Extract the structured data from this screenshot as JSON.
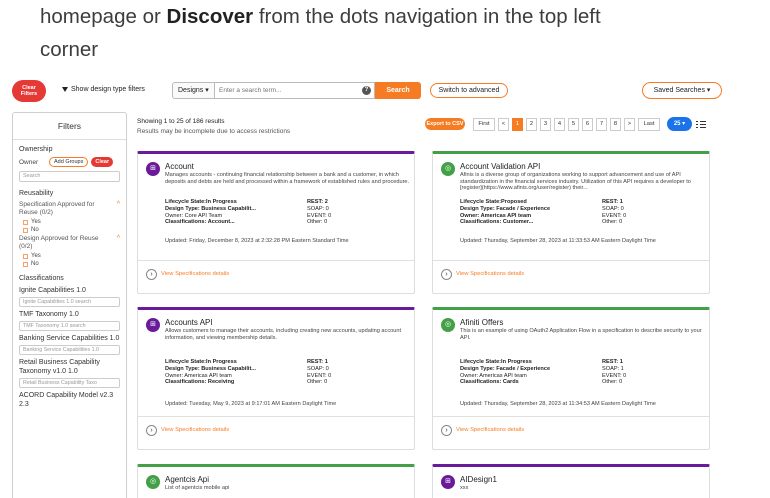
{
  "intro": {
    "line1_pre": "homepage or ",
    "line1_bold": "Discover",
    "line1_post": " from the dots navigation in the top left",
    "line2": "corner"
  },
  "toolbar": {
    "clear_filters_line1": "Clear",
    "clear_filters_line2": "Filters",
    "show_design_type": "Show design type filters",
    "designs_select": "Designs ▾",
    "search_placeholder": "Enter a search term...",
    "search_label": "Search",
    "advanced_label": "Switch to advanced",
    "saved_label": "Saved Searches ▾"
  },
  "filters": {
    "title": "Filters",
    "ownership": "Ownership",
    "owner": "Owner",
    "add_groups": "Add Groups",
    "clear": "Clear",
    "search_placeholder": "Search",
    "reusability": "Reusability",
    "spec_approved_line1": "Specification Approved for",
    "spec_approved_line2": "Reuse (0/2)",
    "design_approved_line1": "Design Approved for Reuse",
    "design_approved_line2": "(0/2)",
    "yes": "Yes",
    "no": "No",
    "classifications": "Classifications",
    "groups": [
      {
        "label": "Ignite Capabilities 1.0",
        "search": "Ignite Capabilities 1.0 search"
      },
      {
        "label": "TMF Taxonomy 1.0",
        "search": "TMF Taxonomy 1.0 search"
      },
      {
        "label": "Banking Service Capabilities 1.0",
        "search": "Banking Service Capabilities 1.0"
      },
      {
        "label": "Retail Business Capability Taxonomy v1.0 1.0",
        "search": "Retail Business Capability Taxo"
      },
      {
        "label": "ACORD Capability Model v2.3 2.3",
        "search": ""
      }
    ]
  },
  "results": {
    "showing": "Showing 1 to 25 of 186 results",
    "note": "Results may be incomplete due to access restrictions",
    "export": "Export to CSV",
    "first": "First",
    "prev": "<",
    "pages": [
      "1",
      "2",
      "3",
      "4",
      "5",
      "6",
      "7",
      "8"
    ],
    "next": ">",
    "last": "Last",
    "per_page": "25 ▾"
  },
  "cards": [
    {
      "title": "Account",
      "desc": "Manages accounts - continuing financial relationship between a bank and a customer, in which deposits and debts are held and processed within a framework of established rules and procedure.",
      "lifecycle": "Lifecycle State:In Progress",
      "design_type": "Design Type: Business Capabilit...",
      "owner": "Owner: Core API Team",
      "classifications": "Classifications: Account...",
      "rest": "REST: 2",
      "soap": "SOAP: 0",
      "event": "EVENT: 0",
      "other": "Other: 0",
      "updated": "Updated: Friday, December 8, 2023 at 2:32:28 PM Eastern Standard Time",
      "link": "View Specifications details"
    },
    {
      "title": "Account Validation API",
      "desc": "Afinis is a diverse group of organizations working to support advancement and use of API standardization in the financial services industry. Utilization of this API requires a developer to [register](https://www.afinis.org/user/register) their...",
      "lifecycle": "Lifecycle State:Proposed",
      "design_type": "Design Type: Facade / Experience",
      "owner": "Owner: Americas API team",
      "classifications": "Classifications: Customer...",
      "rest": "REST: 1",
      "soap": "SOAP: 0",
      "event": "EVENT: 0",
      "other": "Other: 0",
      "updated": "Updated: Thursday, September 28, 2023 at 11:33:53 AM Eastern Daylight Time",
      "link": "View Specifications details"
    },
    {
      "title": "Accounts API",
      "desc": "Allows customers to manage their accounts, including creating new accounts, updating account information, and viewing membership details.",
      "lifecycle": "Lifecycle State:In Progress",
      "design_type": "Design Type: Business Capabilit...",
      "owner": "Owner: Americas API team",
      "classifications": "Classifications: Receiving",
      "rest": "REST: 1",
      "soap": "SOAP: 0",
      "event": "EVENT: 0",
      "other": "Other: 0",
      "updated": "Updated: Tuesday, May 9, 2023 at 9:17:01 AM Eastern Daylight Time",
      "link": "View Specifications details"
    },
    {
      "title": "Afiniti Offers",
      "desc": "This is an example of using OAuth2 Application Flow in a specification to describe security to your API.",
      "lifecycle": "Lifecycle State:In Progress",
      "design_type": "Design Type: Facade / Experience",
      "owner": "Owner: Americas API team",
      "classifications": "Classifications: Cards",
      "rest": "REST: 1",
      "soap": "SOAP: 1",
      "event": "EVENT: 0",
      "other": "Other: 0",
      "updated": "Updated: Thursday, September 28, 2023 at 11:34:53 AM Eastern Daylight Time",
      "link": "View Specifications details"
    },
    {
      "title": "Agentcis Api",
      "desc": "List of agentcis mobile api"
    },
    {
      "title": "AIDesign1",
      "desc": "xxx"
    }
  ],
  "colors": {
    "accent": "#f57c23",
    "danger": "#e53935",
    "purple": "#6a1b9a",
    "green": "#43a047",
    "blue": "#1a73e8"
  }
}
